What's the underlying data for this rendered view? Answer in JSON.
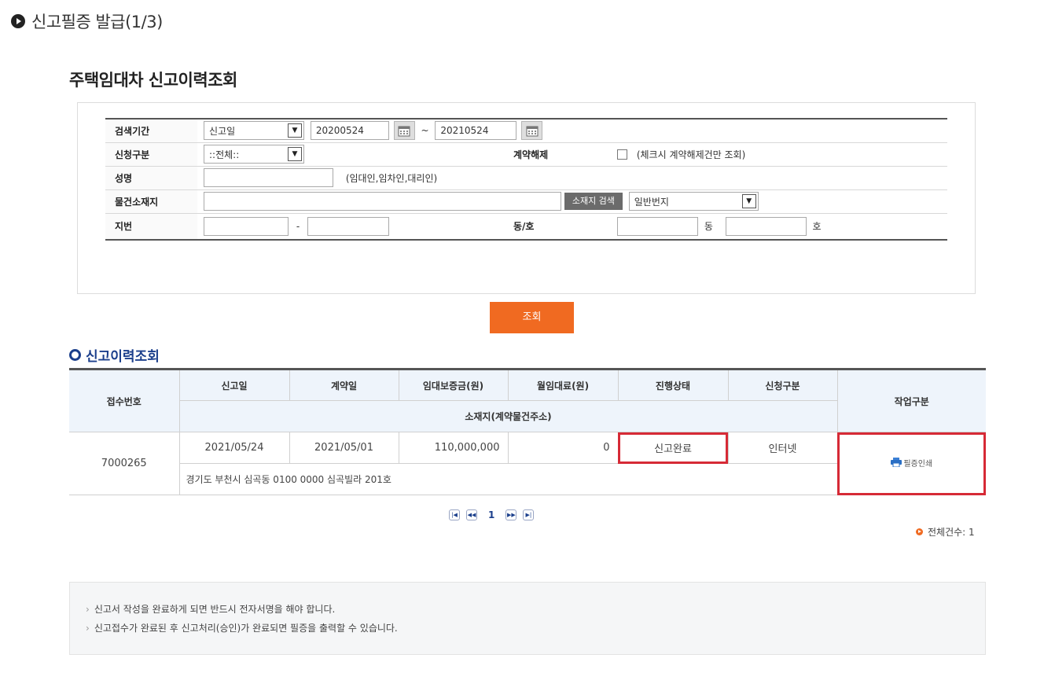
{
  "step_header": "신고필증 발급(1/3)",
  "page_title": "주택임대차 신고이력조회",
  "search": {
    "labels": {
      "period": "검색기간",
      "request_type": "신청구분",
      "cancel": "계약해제",
      "name": "성명",
      "location": "물건소재지",
      "lot": "지번",
      "dong_ho": "동/호"
    },
    "date_type": "신고일",
    "date_from": "20200524",
    "tilde": "~",
    "date_to": "20210524",
    "request_type_value": "::전체::",
    "cancel_note": "(체크시 계약해제건만 조회)",
    "name_hint": "(임대인,임차인,대리인)",
    "location_search_label": "소재지 검색",
    "address_type": "일반번지",
    "dash": "-",
    "dong_unit": "동",
    "ho_unit": "호",
    "submit_label": "조회"
  },
  "results": {
    "section_title": "신고이력조회",
    "headers": {
      "receipt_no": "접수번호",
      "report_date": "신고일",
      "contract_date": "계약일",
      "deposit": "임대보증금(원)",
      "monthly_rent": "월임대료(원)",
      "status": "진행상태",
      "request_type": "신청구분",
      "work_type": "작업구분",
      "address": "소재지(계약물건주소)"
    },
    "rows": [
      {
        "receipt_no": "7000265",
        "report_date": "2021/05/24",
        "contract_date": "2021/05/01",
        "deposit": "110,000,000",
        "monthly_rent": "0",
        "status": "신고완료",
        "request_type": "인터넷",
        "address": "경기도 부천시 심곡동 0100 0000 심곡빌라 201호",
        "action_label": "필증인쇄"
      }
    ],
    "pager": {
      "current_page": "1"
    },
    "total_label": "전체건수: 1"
  },
  "notices": [
    "신고서 작성을 완료하게 되면 반드시 전자서명을 해야 합니다.",
    "신고접수가 완료된 후 신고처리(승인)가 완료되면 필증을 출력할 수 있습니다."
  ],
  "colors": {
    "accent_orange": "#f06a21",
    "heading_navy": "#1b3f8c",
    "highlight_red": "#d62a36",
    "header_bg": "#eef4fb"
  }
}
